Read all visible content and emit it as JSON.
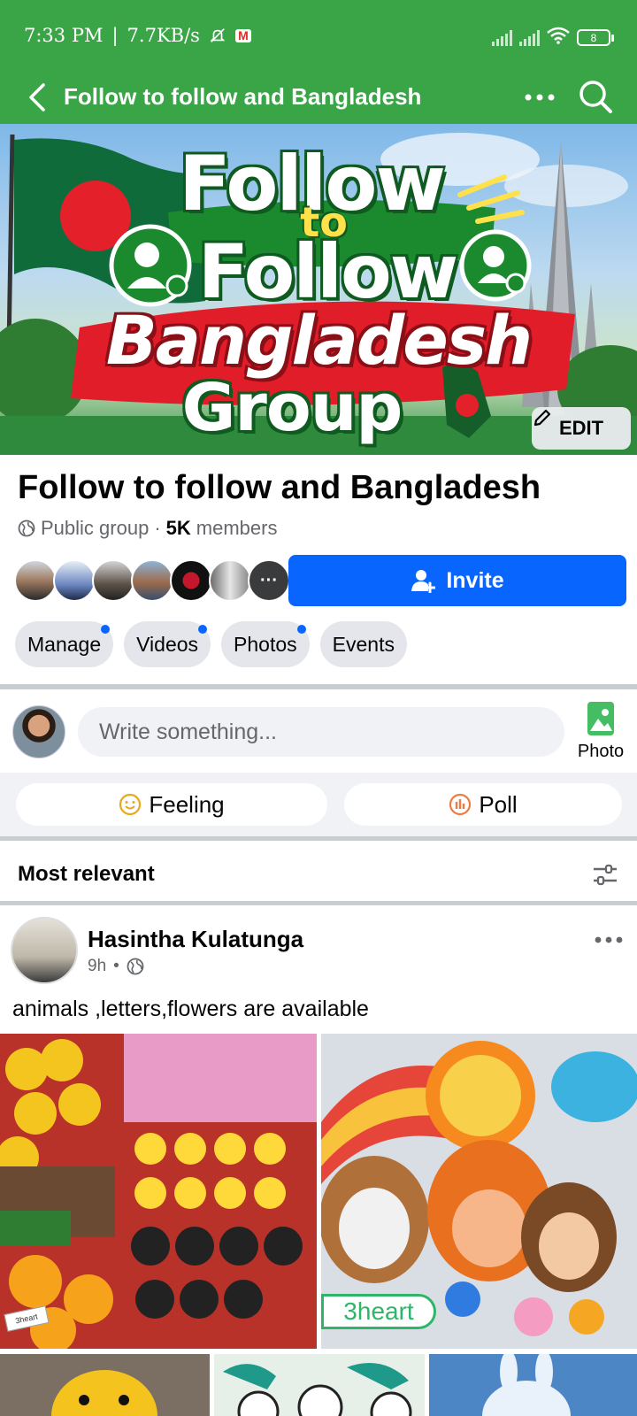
{
  "status_bar": {
    "time": "7:33 PM",
    "separator": "|",
    "network_speed": "7.7KB/s",
    "battery": "8",
    "icons": [
      "mute-icon",
      "gmail-icon",
      "signal-icon",
      "signal-icon",
      "wifi-icon",
      "battery-icon"
    ]
  },
  "header": {
    "title": "Follow to follow and Bangladesh"
  },
  "cover": {
    "line1": "Follow",
    "line2": "to",
    "line3": "Follow",
    "line4": "Bangladesh",
    "line5": "Group",
    "edit_label": "EDIT"
  },
  "group": {
    "name": "Follow to follow and Bangladesh",
    "privacy": "Public group",
    "separator": "·",
    "member_count": "5K",
    "members_label": "members",
    "invite_label": "Invite",
    "more_members": "···"
  },
  "chips": [
    {
      "label": "Manage",
      "dot": true
    },
    {
      "label": "Videos",
      "dot": true
    },
    {
      "label": "Photos",
      "dot": true
    },
    {
      "label": "Events",
      "dot": false
    }
  ],
  "composer": {
    "placeholder": "Write something...",
    "photo_label": "Photo",
    "feeling_label": "Feeling",
    "poll_label": "Poll"
  },
  "feed": {
    "sort_label": "Most relevant"
  },
  "post": {
    "author": "Hasintha Kulatunga",
    "time": "9h",
    "dot": "•",
    "text": "animals ,letters,flowers are available",
    "watermark": "3heart",
    "stamp": "3heart"
  },
  "colors": {
    "brand_green": "#3aa547",
    "accent_blue": "#0866ff",
    "chip_bg": "#e4e6eb"
  }
}
